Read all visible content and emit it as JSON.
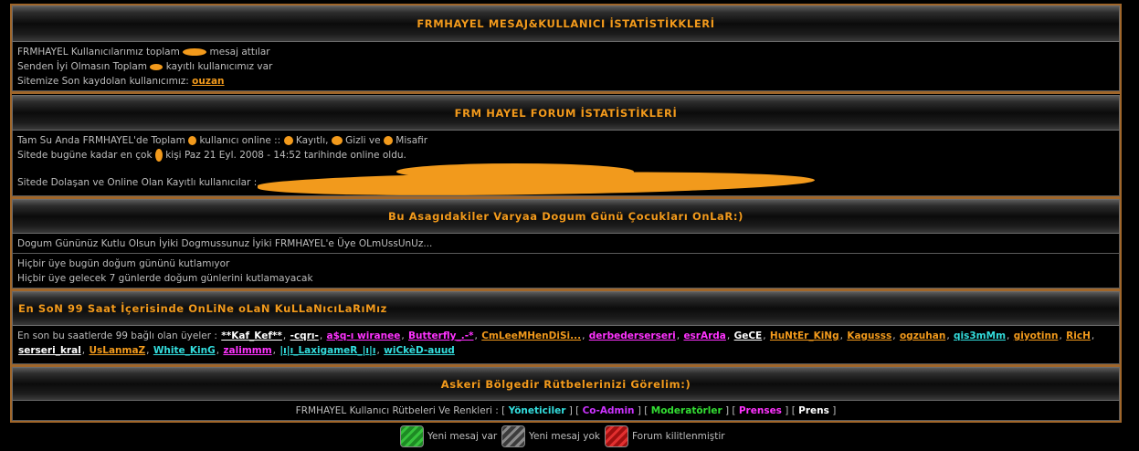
{
  "stats_section": {
    "title": "FRMHAYEL MESAJ&KULLANICI İSTATİSTİKKLERİ",
    "line1_prefix": "FRMHAYEL Kullanıcılarımız toplam",
    "line1_suffix": "mesaj attılar",
    "line2_prefix": "Senden İyi Olmasın Toplam",
    "line2_suffix": "kayıtlı kullanıcımız var",
    "line3_prefix": "Sitemize Son kaydolan kullanıcımız:",
    "newest_user": "ouzan"
  },
  "forum_section": {
    "title": "FRM HAYEL FORUM İSTATİSTİKLERİ",
    "online_p1": "Tam Su Anda FRMHAYEL'de Toplam",
    "online_p2": "kullanıcı online ::",
    "online_p3": "Kayıtlı,",
    "online_p4": "Gizli ve",
    "online_p5": "Misafir",
    "record_p1": "Sitede bugüne kadar en çok",
    "record_p2": "kişi Paz 21 Eyl. 2008 - 14:52 tarihinde online oldu.",
    "registered_label": "Sitede Dolaşan ve Online Olan Kayıtlı kullanıcılar :"
  },
  "birthday_section": {
    "title": "Bu Asagıdakiler Varyaa Dogum Günü Çocukları OnLaR:)",
    "message": "Dogum Gününüz Kutlu Olsun İyiki Dogmussunuz İyiki FRMHAYEL'e Üye OLmUssUnUz...",
    "today": "Hiçbir üye bugün doğum gününü kutlamıyor",
    "upcoming": "Hiçbir üye gelecek 7 günlerde doğum günlerini kutlamayacak"
  },
  "recent_section": {
    "title": "En SoN 99 Saat İçerisinde OnLiNe oLaN KuLLaNıcıLaRıMız",
    "intro": "En son bu saatlerde 99 bağlı olan üyeler :",
    "users": [
      {
        "name": "**Kaf_Kef**",
        "color": "#ffffff"
      },
      {
        "name": "-cqrı-",
        "color": "#ffffff"
      },
      {
        "name": "a$q-ı wiranee",
        "color": "#ff33ff"
      },
      {
        "name": "Butterfly_.-*",
        "color": "#ff33ff"
      },
      {
        "name": "CmLeeMHenDiSi...",
        "color": "#f29a1c"
      },
      {
        "name": "derbederserseri",
        "color": "#ff33ff"
      },
      {
        "name": "esrArda",
        "color": "#ff33ff"
      },
      {
        "name": "GeCE",
        "color": "#ffffff"
      },
      {
        "name": "HuNtEr_KiNg",
        "color": "#f29a1c"
      },
      {
        "name": "Kagusss",
        "color": "#f29a1c"
      },
      {
        "name": "ogzuhan",
        "color": "#f29a1c"
      },
      {
        "name": "qis3mMm",
        "color": "#33dddd"
      },
      {
        "name": "giyotinn",
        "color": "#f29a1c"
      },
      {
        "name": "RicH",
        "color": "#f29a1c"
      },
      {
        "name": "serseri_kral",
        "color": "#ffffff"
      },
      {
        "name": "UsLanmaZ",
        "color": "#f29a1c"
      },
      {
        "name": "White_KinG",
        "color": "#33dddd"
      },
      {
        "name": "zalimmm",
        "color": "#ff33ff"
      },
      {
        "name": "|ı|ı_LaxigameR_|ı|ı",
        "color": "#33dddd"
      },
      {
        "name": "wiCkèD-auud",
        "color": "#33dddd"
      }
    ]
  },
  "ranks_section": {
    "title": "Askeri Bölgedir Rütbelerinizi Görelim:)",
    "intro": "FRMHAYEL Kullanıcı Rütbeleri Ve Renkleri :",
    "ranks": [
      {
        "name": "Yöneticiler",
        "color": "#33dddd"
      },
      {
        "name": "Co-Admin",
        "color": "#cc33ff"
      },
      {
        "name": "Moderatörler",
        "color": "#33dd33"
      },
      {
        "name": "Prenses",
        "color": "#ff33ff"
      },
      {
        "name": "Prens",
        "color": "#ffffff"
      }
    ]
  },
  "legend": {
    "new_posts": "Yeni mesaj var",
    "no_new_posts": "Yeni mesaj yok",
    "locked": "Forum kilitlenmiştir"
  }
}
